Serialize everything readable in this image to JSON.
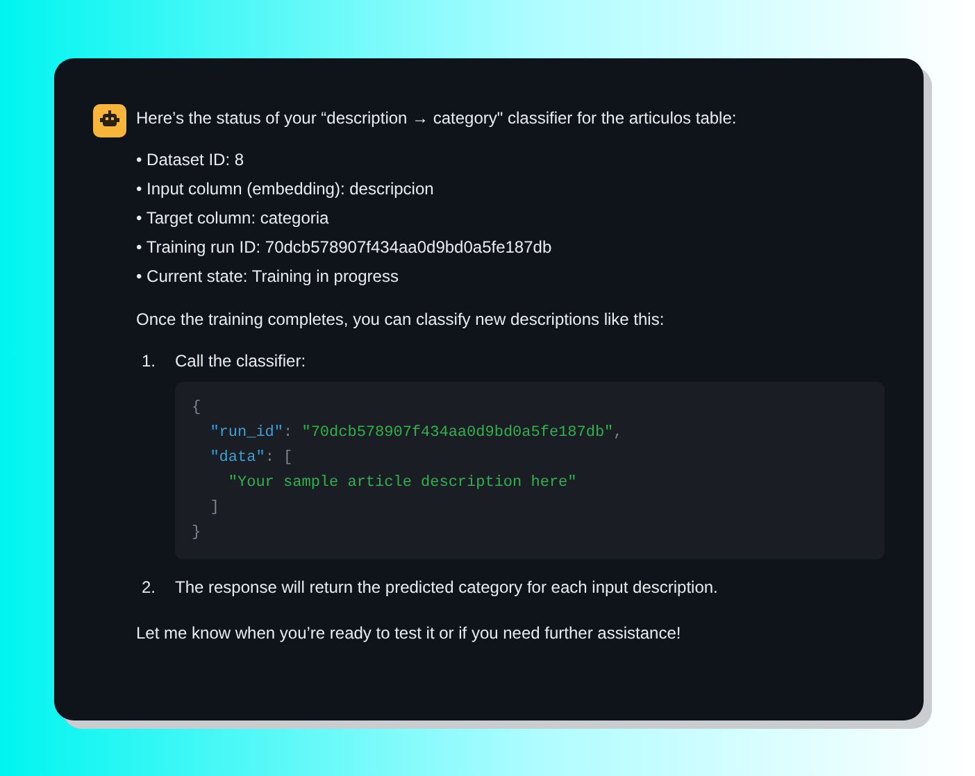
{
  "message": {
    "intro": "Here’s the status of your “description → category\" classifier for the articulos table:",
    "bullets": [
      "• Dataset ID: 8",
      "• Input column (embedding): descripcion",
      "• Target column: categoria",
      "• Training run ID: 70dcb578907f434aa0d9bd0a5fe187db",
      "• Current state: Training in progress"
    ],
    "lead": "Once the training completes, you can classify new descriptions like this:",
    "steps": [
      {
        "number": "1.",
        "text": "Call the classifier:",
        "code": [
          [
            {
              "kind": "punct",
              "text": "{"
            }
          ],
          [
            {
              "kind": "key",
              "text": "  \"run_id\""
            },
            {
              "kind": "punct",
              "text": ": "
            },
            {
              "kind": "string",
              "text": "\"70dcb578907f434aa0d9bd0a5fe187db\""
            },
            {
              "kind": "punct",
              "text": ","
            }
          ],
          [
            {
              "kind": "key",
              "text": "  \"data\""
            },
            {
              "kind": "punct",
              "text": ": ["
            }
          ],
          [
            {
              "kind": "string",
              "text": "    \"Your sample article description here\""
            }
          ],
          [
            {
              "kind": "punct",
              "text": "  ]"
            }
          ],
          [
            {
              "kind": "punct",
              "text": "}"
            }
          ]
        ]
      },
      {
        "number": "2.",
        "text": "The response will return the predicted category for each input description."
      }
    ],
    "closing": "Let me know when you’re ready to test it or if you need further assistance!"
  }
}
